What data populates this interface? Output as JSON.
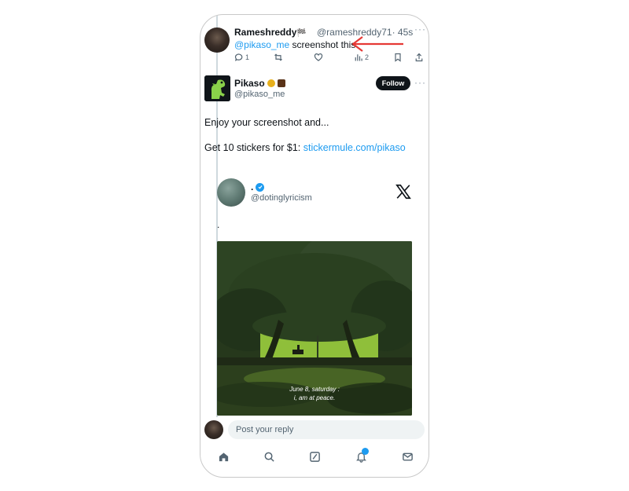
{
  "reply_tweet": {
    "author_name": "Rameshreddy",
    "name_emoji": "🏁",
    "handle": "@rameshreddy71",
    "time": "· 45s",
    "mention": "@pikaso_me",
    "text": " screenshot this",
    "reply_count": "1",
    "views_count": "2"
  },
  "main_tweet": {
    "author_name": "Pikaso",
    "handle": "@pikaso_me",
    "follow_label": "Follow",
    "line1": "Enjoy your screenshot and...",
    "line2_prefix": "Get 10 stickers for $1: ",
    "line2_link": "stickermule.com/pikaso"
  },
  "quoted_tweet": {
    "author_name": ".",
    "handle": "@dotinglyricism",
    "text": ".",
    "caption_line1": "June 8, saturday :",
    "caption_line2": "i, am at peace."
  },
  "reply_bar": {
    "placeholder": "Post your reply"
  },
  "tabbar": {
    "tabs": [
      "home-icon",
      "search-icon",
      "compose-icon",
      "notifications-icon",
      "messages-icon"
    ]
  },
  "colors": {
    "link": "#1d9bf0",
    "annotation_arrow": "#e53935",
    "follow_bg": "#0f1419"
  }
}
